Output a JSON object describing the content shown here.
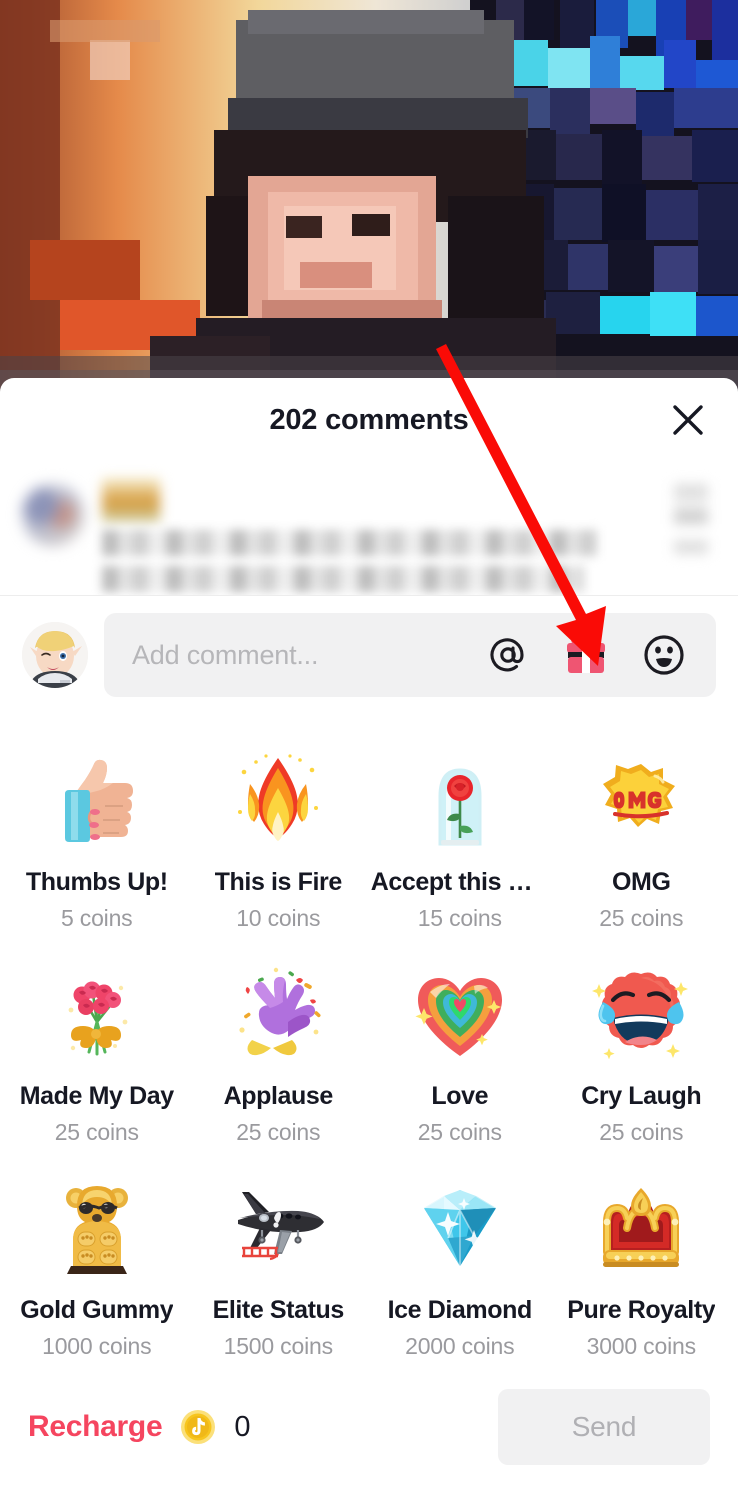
{
  "video": {
    "description": "pixelated video background with warm orange left side, dark figure center, blue neon right side"
  },
  "header": {
    "title": "202 comments",
    "close_icon": "close-icon"
  },
  "comment_list": {
    "blurred": "comments are blurred for privacy"
  },
  "input_bar": {
    "avatar_icon": "user-avatar",
    "placeholder": "Add comment...",
    "mention_icon": "at-icon",
    "gift_icon": "gift-icon",
    "emoji_icon": "emoji-icon"
  },
  "gifts": [
    {
      "name": "Thumbs Up!",
      "price": "5 coins",
      "icon": "thumbs-up-gift"
    },
    {
      "name": "This is Fire",
      "price": "10 coins",
      "icon": "fire-gift"
    },
    {
      "name": "Accept this Ro…",
      "price": "15 coins",
      "icon": "rose-in-glass-gift"
    },
    {
      "name": "OMG",
      "price": "25 coins",
      "icon": "omg-gift"
    },
    {
      "name": "Made My Day",
      "price": "25 coins",
      "icon": "bouquet-gift"
    },
    {
      "name": "Applause",
      "price": "25 coins",
      "icon": "applause-gift"
    },
    {
      "name": "Love",
      "price": "25 coins",
      "icon": "rainbow-heart-gift"
    },
    {
      "name": "Cry Laugh",
      "price": "25 coins",
      "icon": "cry-laugh-gift"
    },
    {
      "name": "Gold Gummy",
      "price": "1000 coins",
      "icon": "gold-gummy-bear-gift"
    },
    {
      "name": "Elite Status",
      "price": "1500 coins",
      "icon": "private-jet-gift"
    },
    {
      "name": "Ice Diamond",
      "price": "2000 coins",
      "icon": "diamond-gift"
    },
    {
      "name": "Pure Royalty",
      "price": "3000 coins",
      "icon": "crown-gift"
    }
  ],
  "bottom_bar": {
    "recharge_label": "Recharge",
    "coin_icon": "tiktok-coin-icon",
    "coin_balance": "0",
    "send_label": "Send"
  },
  "annotation": {
    "arrow": "red-arrow pointing to gift icon"
  },
  "colors": {
    "accent_red": "#f5455f",
    "gift_pink": "#ef5572",
    "text_primary": "#161823",
    "text_muted": "#9a9a9e",
    "pill_bg": "#f1f1f2",
    "arrow_red": "#fa0b06",
    "coin_gold": "#f7c51e"
  }
}
